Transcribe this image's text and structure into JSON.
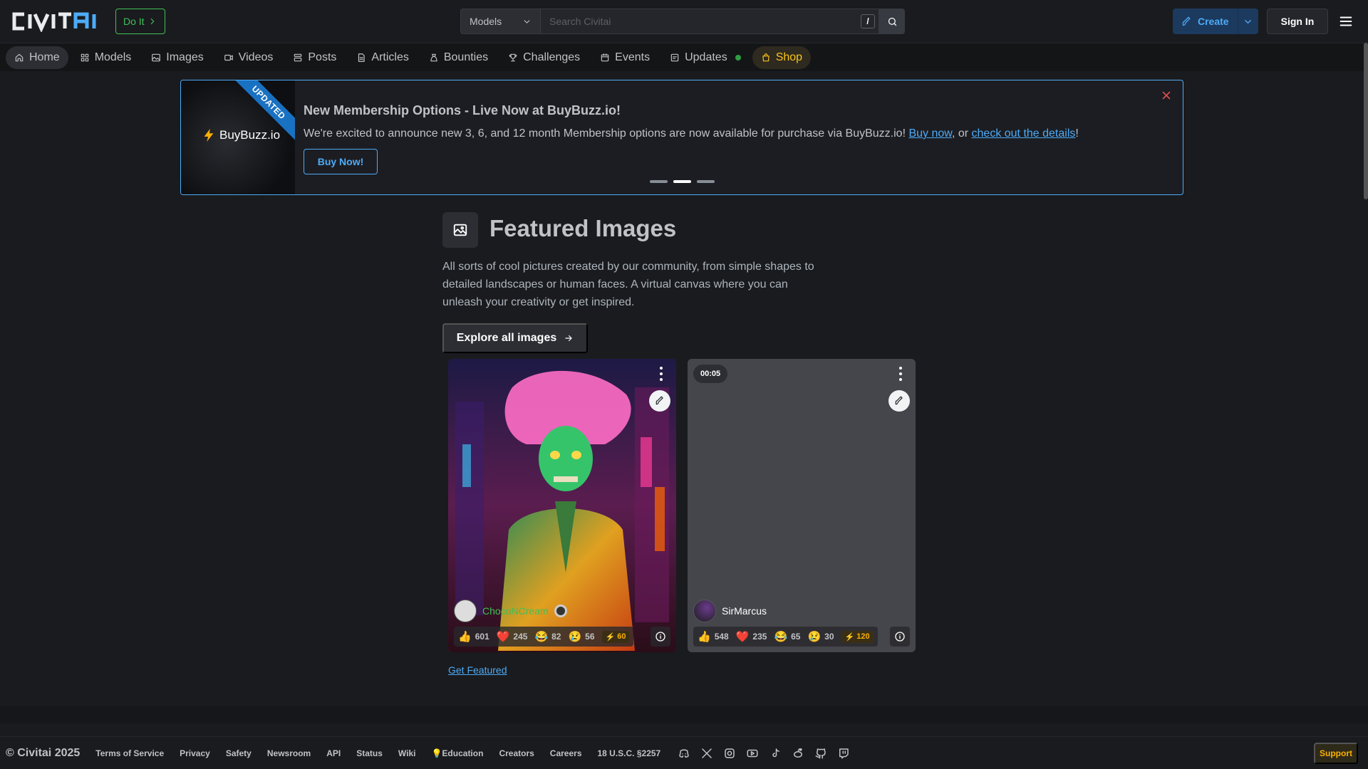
{
  "header": {
    "logo_alt": "CIVITAI",
    "doit_label": "Do It",
    "search_category": "Models",
    "search_placeholder": "Search Civitai",
    "search_shortcut": "/",
    "create_label": "Create",
    "signin_label": "Sign In"
  },
  "nav": {
    "items": [
      {
        "label": "Home",
        "icon": "home-icon",
        "active": true
      },
      {
        "label": "Models",
        "icon": "grid-icon"
      },
      {
        "label": "Images",
        "icon": "image-icon"
      },
      {
        "label": "Videos",
        "icon": "video-icon"
      },
      {
        "label": "Posts",
        "icon": "posts-icon"
      },
      {
        "label": "Articles",
        "icon": "article-icon"
      },
      {
        "label": "Bounties",
        "icon": "bounty-icon"
      },
      {
        "label": "Challenges",
        "icon": "trophy-icon"
      },
      {
        "label": "Events",
        "icon": "calendar-icon"
      },
      {
        "label": "Updates",
        "icon": "updates-icon"
      },
      {
        "label": "Shop",
        "icon": "shop-icon"
      }
    ]
  },
  "banner": {
    "ribbon": "UPDATED",
    "brand": "BuyBuzz.io",
    "title": "New Membership Options - Live Now at BuyBuzz.io!",
    "text_before": "We're excited to announce new 3, 6, and 12 month Membership options are now available for purchase via BuyBuzz.io! ",
    "link1": "Buy now",
    "text_mid": ", or ",
    "link2": "check out the details",
    "text_end": "!",
    "button": "Buy Now!"
  },
  "featured": {
    "title": "Featured Images",
    "description": "All sorts of cool pictures created by our community, from simple shapes to detailed landscapes or human faces. A virtual canvas where you can unleash your creativity or get inspired.",
    "explore_label": "Explore all images",
    "get_featured": "Get Featured",
    "cards": [
      {
        "author": "ChocoNCream",
        "duration": "",
        "likes": "601",
        "hearts": "245",
        "laughs": "82",
        "cries": "56",
        "buzz": "60"
      },
      {
        "author": "SirMarcus",
        "duration": "00:05",
        "likes": "548",
        "hearts": "235",
        "laughs": "65",
        "cries": "30",
        "buzz": "120"
      }
    ]
  },
  "footer": {
    "copyright": "© Civitai 2025",
    "links": [
      "Terms of Service",
      "Privacy",
      "Safety",
      "Newsroom",
      "API",
      "Status",
      "Wiki",
      "💡Education",
      "Creators",
      "Careers",
      "18 U.S.C. §2257"
    ],
    "socials": [
      "discord-icon",
      "x-icon",
      "instagram-icon",
      "youtube-icon",
      "tiktok-icon",
      "reddit-icon",
      "github-icon",
      "twitch-icon"
    ],
    "support": "Support"
  },
  "colors": {
    "accent": "#4dabf7",
    "green": "#40c057",
    "buzz": "#fab005",
    "background": "#1a1b1e"
  }
}
